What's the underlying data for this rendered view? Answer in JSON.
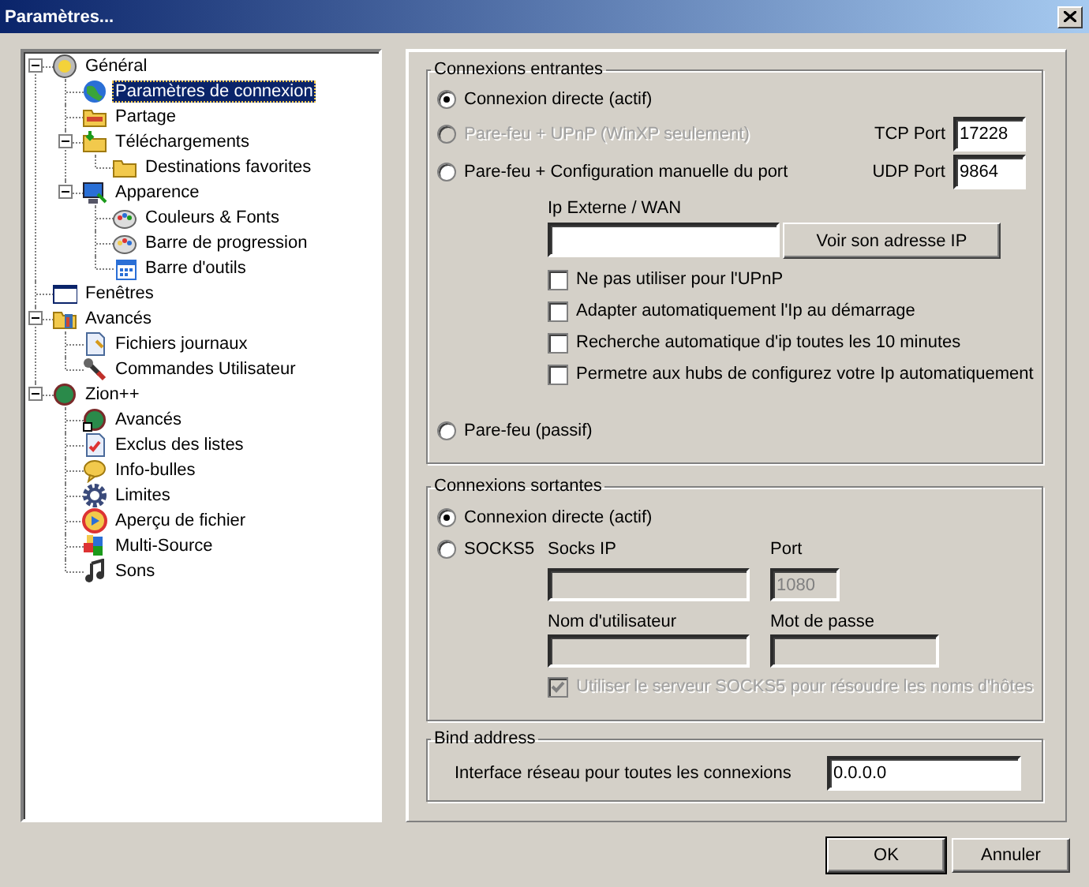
{
  "window": {
    "title": "Paramètres..."
  },
  "tree": [
    {
      "label": "Général",
      "selected": false,
      "expanded": true,
      "children": [
        {
          "label": "Paramètres de connexion",
          "selected": true
        },
        {
          "label": "Partage",
          "selected": false
        },
        {
          "label": "Téléchargements",
          "selected": false,
          "expanded": true,
          "children": [
            {
              "label": "Destinations favorites",
              "selected": false
            }
          ]
        },
        {
          "label": "Apparence",
          "selected": false,
          "expanded": true,
          "children": [
            {
              "label": "Couleurs & Fonts",
              "selected": false
            },
            {
              "label": "Barre de progression",
              "selected": false
            },
            {
              "label": "Barre d'outils",
              "selected": false
            }
          ]
        }
      ]
    },
    {
      "label": "Fenêtres",
      "selected": false
    },
    {
      "label": "Avancés",
      "selected": false,
      "expanded": true,
      "children": [
        {
          "label": "Fichiers journaux",
          "selected": false
        },
        {
          "label": "Commandes Utilisateur",
          "selected": false
        }
      ]
    },
    {
      "label": "Zion++",
      "selected": false,
      "expanded": true,
      "children": [
        {
          "label": "Avancés",
          "selected": false
        },
        {
          "label": "Exclus des listes",
          "selected": false
        },
        {
          "label": "Info-bulles",
          "selected": false
        },
        {
          "label": "Limites",
          "selected": false
        },
        {
          "label": "Aperçu de fichier",
          "selected": false
        },
        {
          "label": "Multi-Source",
          "selected": false
        },
        {
          "label": "Sons",
          "selected": false
        }
      ]
    }
  ],
  "incoming": {
    "title": "Connexions entrantes",
    "options": [
      {
        "label": "Connexion directe (actif)",
        "selected": true,
        "disabled": false
      },
      {
        "label": "Pare-feu + UPnP (WinXP seulement)",
        "selected": false,
        "disabled": true
      },
      {
        "label": "Pare-feu + Configuration manuelle du port",
        "selected": false,
        "disabled": false
      }
    ],
    "ports": [
      {
        "label": "TCP Port",
        "value": "17228"
      },
      {
        "label": "UDP Port",
        "value": "9864"
      }
    ],
    "external_ip": {
      "label": "Ip Externe / WAN"
    },
    "show_ip_button": "Voir son adresse IP",
    "checkboxes": [
      {
        "label": "Ne pas utiliser pour l'UPnP",
        "checked": false
      },
      {
        "label": "Adapter automatiquement l'Ip au démarrage",
        "checked": false
      },
      {
        "label": "Recherche automatique d'ip toutes les 10 minutes",
        "checked": false
      },
      {
        "label": "Permetre aux hubs de configurez votre Ip automatiquement",
        "checked": false
      }
    ],
    "passive_option": {
      "label": "Pare-feu (passif)",
      "selected": false
    }
  },
  "outgoing": {
    "title": "Connexions sortantes",
    "options": [
      {
        "label": "Connexion directe (actif)",
        "selected": true
      },
      {
        "label": "SOCKS5",
        "selected": false
      }
    ],
    "socks_disabled": true,
    "socks_ip": {
      "label": "Socks IP"
    },
    "port": {
      "label": "Port",
      "value": "1080"
    },
    "username": {
      "label": "Nom d'utilisateur"
    },
    "password": {
      "label": "Mot de passe"
    },
    "resolve_checkbox": {
      "label": "Utiliser le serveur SOCKS5 pour résoudre les noms d'hôtes",
      "checked": true
    }
  },
  "bind": {
    "title": "Bind address",
    "label": "Interface réseau pour toutes les connexions",
    "value": "0.0.0.0"
  },
  "buttons": [
    {
      "label": "OK",
      "default": true
    },
    {
      "label": "Annuler",
      "default": false
    }
  ]
}
